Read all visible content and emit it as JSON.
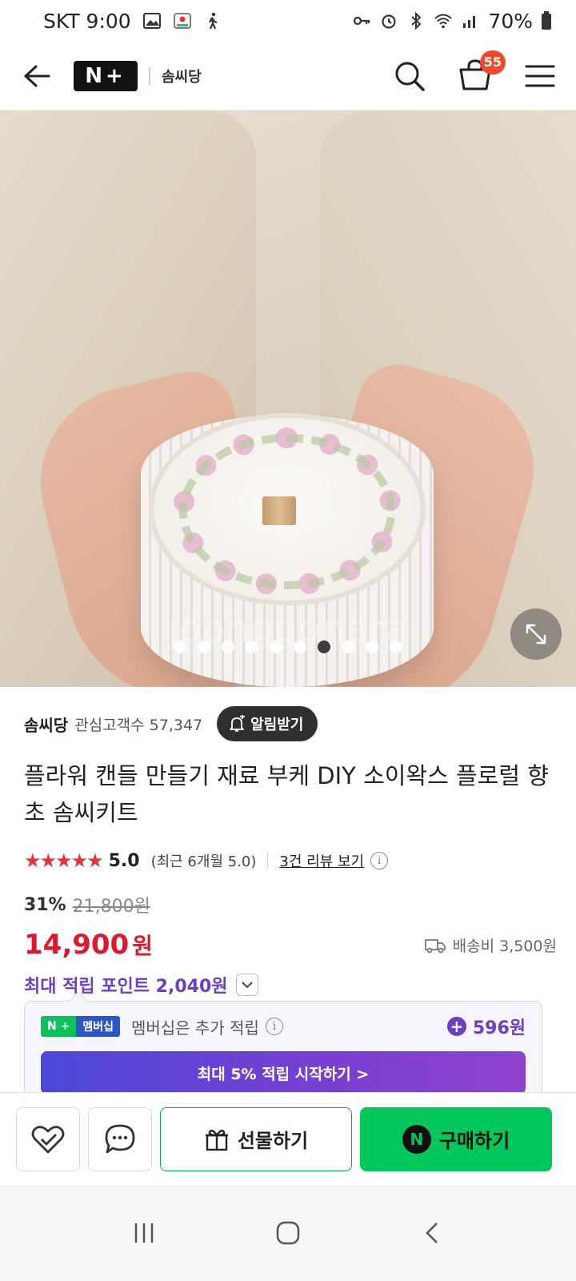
{
  "status_bar": {
    "carrier_time": "SKT 9:00",
    "battery": "70%"
  },
  "header": {
    "brand_logo": "N+",
    "store_logo": "솜씨당",
    "cart_count": "55",
    "icons": [
      "back-arrow-icon",
      "search-icon",
      "cart-icon",
      "menu-icon"
    ]
  },
  "gallery": {
    "watermark": "joonggonara",
    "total_images": 10,
    "active_index": 6
  },
  "seller": {
    "name": "솜씨당",
    "followers": "관심고객수 57,347",
    "alarm_label": "알림받기"
  },
  "product": {
    "title": "플라워 캔들 만들기 재료 부케 DIY 소이왁스 플로럴 향초 솜씨키트",
    "rating_stars": "★★★★★",
    "rating_score": "5.0",
    "rating_recent": "(최근 6개월 5.0)",
    "review_link": "3건 리뷰 보기",
    "discount": "31%",
    "original_price": "21,800원",
    "price": "14,900",
    "currency": "원",
    "shipping": "배송비 3,500원",
    "max_points": "최대 적립 포인트 2,040원"
  },
  "membership": {
    "badge_n": "N +",
    "badge_label": "멤버십",
    "text": "멤버십은 추가 적립",
    "points": "596원",
    "cta": "최대 5% 적립 시작하기 >"
  },
  "actions": {
    "gift_label": "선물하기",
    "buy_label": "구매하기",
    "buy_badge": "N"
  },
  "colors": {
    "price_red": "#e0182e",
    "point_purple": "#6b3fc0",
    "naver_green": "#03c75a",
    "star_red": "#e0343e"
  }
}
